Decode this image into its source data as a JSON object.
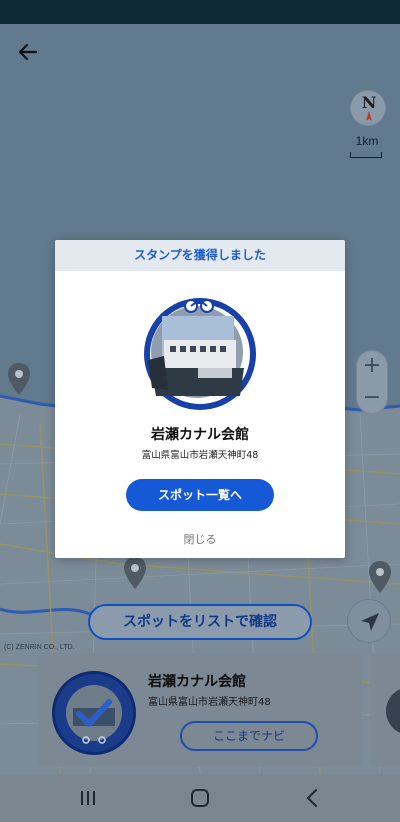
{
  "colors": {
    "status_bar": "#0e2a36",
    "primary": "#1659d6",
    "dialog_header_bg": "#e4e8ef",
    "dialog_header_text": "#1f5fcf"
  },
  "map": {
    "copyright": "(C) ZENRIN CO., LTD.",
    "scale_label": "1km",
    "list_button_label": "スポットをリストで確認"
  },
  "dialog": {
    "header": "スタンプを獲得しました",
    "spot_name": "岩瀬カナル会館",
    "address": "富山県富山市岩瀬天神町48",
    "primary_button": "スポット一覧へ",
    "close": "閉じる"
  },
  "card": {
    "title": "岩瀬カナル会館",
    "address": "富山県富山市岩瀬天神町48",
    "navi_button": "ここまでナビ"
  },
  "icons": {
    "back": "back-arrow-icon",
    "compass": "compass-icon",
    "zoom_in": "plus-icon",
    "zoom_out": "minus-icon",
    "locate": "location-arrow-icon",
    "map_pin": "map-pin-icon",
    "recents": "recents-icon",
    "home": "home-icon",
    "nav_back": "nav-back-icon"
  }
}
